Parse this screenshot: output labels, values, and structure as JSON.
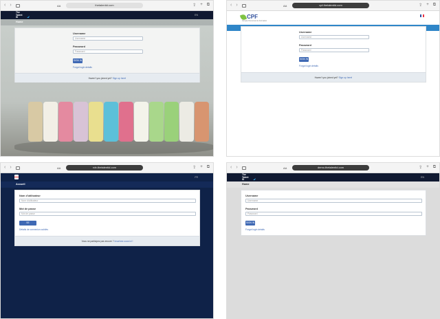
{
  "colors": {
    "accent": "#3f69b4",
    "navy": "#0f2248",
    "header": "#101931",
    "cpf_blue": "#2f86c8"
  },
  "browser": {
    "aa": "AA",
    "icons": [
      "back-icon",
      "forward-icon",
      "book-icon",
      "share-icon",
      "plus-icon",
      "tabs-icon"
    ]
  },
  "panel1": {
    "url": "thetalentid.com",
    "logo": {
      "line1": "The",
      "line2": "Talent",
      "line3": "ID"
    },
    "lang": "EN",
    "subnav": "Home",
    "username_label": "Username",
    "username_placeholder": "Username",
    "password_label": "Password",
    "password_placeholder": "Password",
    "signin": "SIGN IN",
    "forgot": "Forgot login details",
    "footer_text": "Haven't you joined yet?",
    "footer_link": "Sign up here!"
  },
  "panel2": {
    "url": "cpf.thetalentid.com",
    "logo_text": "CPF",
    "logo_sub": "Compte Personnel de Formation",
    "subnav": "Home",
    "username_label": "Username",
    "username_placeholder": "Username",
    "password_label": "Password",
    "password_placeholder": "Password",
    "signin": "SIGN IN",
    "forgot": "Forgot login details",
    "footer_text": "Haven't you joined yet?",
    "footer_link": "Sign up here!"
  },
  "panel3": {
    "url": "rdn.thetalentid.com",
    "lang": "FR",
    "subnav": "Accueil",
    "username_label": "Nom d'utilisateur",
    "username_placeholder": "Nom d'utilisateur",
    "password_label": "Mot de passe",
    "password_placeholder": "Mot de passe",
    "signin": "SE CONNECTER",
    "forgot": "Détails de connexion oubliés",
    "footer_text": "Vous ne participez pas encore ?",
    "footer_link": "Inscrivez-vous ici !"
  },
  "panel4": {
    "url": "demo.thetalentid.com",
    "logo": {
      "line1": "The",
      "line2": "Talent",
      "line3": "ID"
    },
    "lang": "EN",
    "subnav": "Home",
    "username_label": "Username",
    "username_placeholder": "Username",
    "password_label": "Password",
    "password_placeholder": "Password",
    "signin": "SIGN IN",
    "forgot": "Forgot login details"
  }
}
